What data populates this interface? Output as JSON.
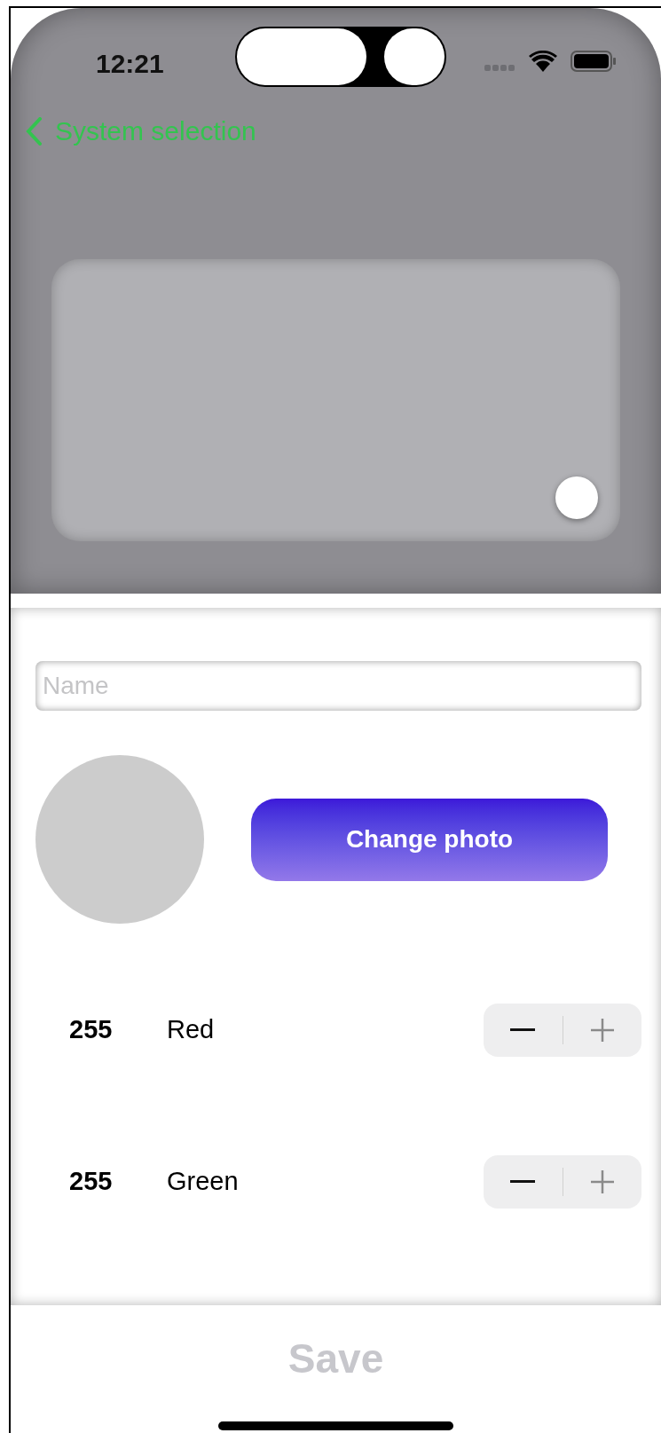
{
  "status_bar": {
    "time": "12:21"
  },
  "nav": {
    "back_label": "System selection"
  },
  "name_field": {
    "placeholder": "Name"
  },
  "photo": {
    "button": "Change photo"
  },
  "channels": [
    {
      "value": "255",
      "name": "Red",
      "decrement_disabled": false,
      "increment_disabled": true
    },
    {
      "value": "255",
      "name": "Green",
      "decrement_disabled": false,
      "increment_disabled": true
    }
  ],
  "save": {
    "label": "Save",
    "disabled": true
  }
}
